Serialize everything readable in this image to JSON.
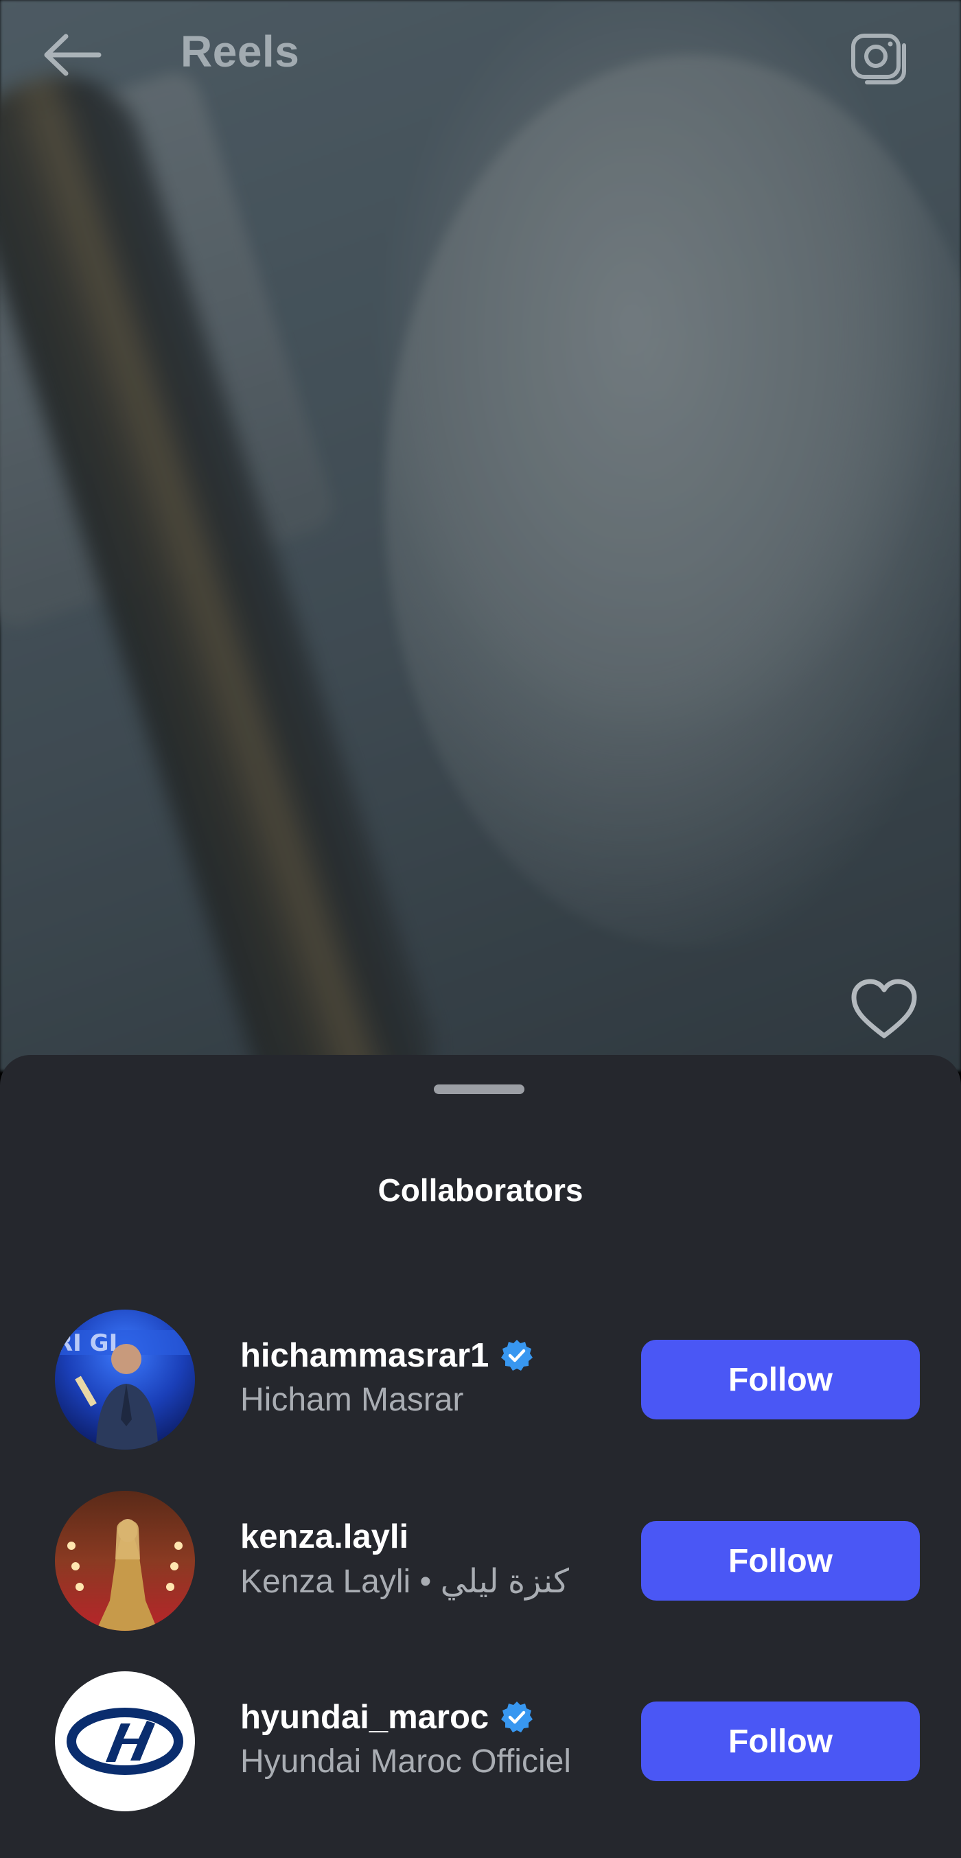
{
  "header": {
    "title": "Reels",
    "back_icon": "arrow-left-icon",
    "camera_icon": "camera-icon"
  },
  "reel": {
    "like_icon": "heart-outline-icon"
  },
  "sheet": {
    "title": "Collaborators",
    "collaborators": [
      {
        "username": "hichammasrar1",
        "full_name": "Hicham Masrar",
        "verified": true,
        "follow_label": "Follow"
      },
      {
        "username": "kenza.layli",
        "full_name": "Kenza Layli • كنزة ليلي",
        "verified": false,
        "follow_label": "Follow"
      },
      {
        "username": "hyundai_maroc",
        "full_name": "Hyundai Maroc Officiel",
        "verified": true,
        "follow_label": "Follow"
      }
    ]
  },
  "colors": {
    "sheet_background": "#25272d",
    "follow_button": "#4a57f5",
    "verified_badge": "#3897f0",
    "secondary_text": "#a9adb3"
  }
}
